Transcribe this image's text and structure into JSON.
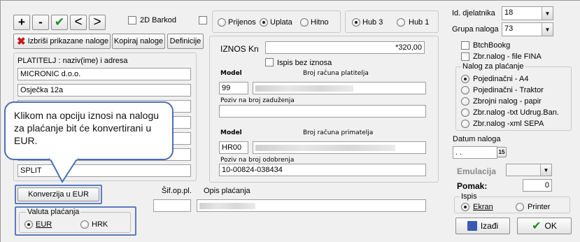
{
  "toolbar": {
    "plus": "+",
    "minus": "-",
    "check": "✔",
    "prev": "<",
    "next": ">",
    "barcode_label": "2D Barkod",
    "delete_label": "Izbriši prikazane naloge",
    "copy_label": "Kopiraj naloge",
    "definitions_label": "Definicije"
  },
  "payment_mode": {
    "options": [
      "Prijenos",
      "Uplata",
      "Hitno"
    ],
    "selected": "Uplata"
  },
  "hub_mode": {
    "options": [
      "Hub 3",
      "Hub 1"
    ],
    "selected": "Hub 3"
  },
  "payer": {
    "title": "PLATITELJ : naziv(ime) i adresa",
    "lines": [
      "MICRONIC d.o.o.",
      "Osječka 12a",
      "",
      "",
      "",
      "",
      "SPLIT"
    ]
  },
  "amount": {
    "label": "IZNOS Kn",
    "value": "*320,00",
    "no_amount_label": "Ispis bez iznosa"
  },
  "payer_account": {
    "model_label": "Model",
    "model_value": "99",
    "account_label": "Broj računa platitelja",
    "charge_ref_label": "Poziv na broj zaduženja"
  },
  "recipient_account": {
    "model_label": "Model",
    "model_value": "HR00",
    "account_label": "Broj računa primatelja",
    "approval_ref_label": "Poziv na broj odobrenja",
    "approval_ref_value": "10-00824-038434"
  },
  "purpose": {
    "code_label": "Šif.op.pl.",
    "desc_label": "Opis plaćanja"
  },
  "callout": {
    "text": "Klikom na opciju iznosi na nalogu za plaćanje bit će konvertirani u EUR."
  },
  "convert_button": {
    "label": "Konverzija u EUR"
  },
  "currency": {
    "title": "Valuta plaćanja",
    "options": [
      "EUR",
      "HRK"
    ],
    "selected": "EUR"
  },
  "right": {
    "activity_id_label": "Id. djelatnika",
    "activity_id_value": "18",
    "group_label": "Grupa naloga",
    "group_value": "73",
    "btch_label": "BtchBookg",
    "fina_label": "Zbr.nalog - file FINA",
    "order_type_title": "Nalog za plaćanje",
    "order_types": [
      "Pojedinačni - A4",
      "Pojedinačni - Traktor",
      "Zbrojni nalog - papir",
      "Zbr.nalog -txt Udrug.Ban.",
      "Zbr.nalog -xml SEPA"
    ],
    "order_type_selected": "Pojedinačni - A4",
    "date_label": "Datum naloga",
    "date_value": ". .",
    "calendar_label": "15",
    "emulation_label": "Emulacija",
    "pomak_label": "Pomak:",
    "pomak_value": "0",
    "print_title": "Ispis",
    "print_options": [
      "Ekran",
      "Printer"
    ],
    "print_selected": "Ekran",
    "exit_label": "Izađi",
    "ok_label": "OK"
  },
  "colors": {
    "highlight": "#5a7bbf",
    "callout_border": "#4a6fb5",
    "ok_check": "#1f8a1f",
    "delete_x": "#c21a1a"
  }
}
